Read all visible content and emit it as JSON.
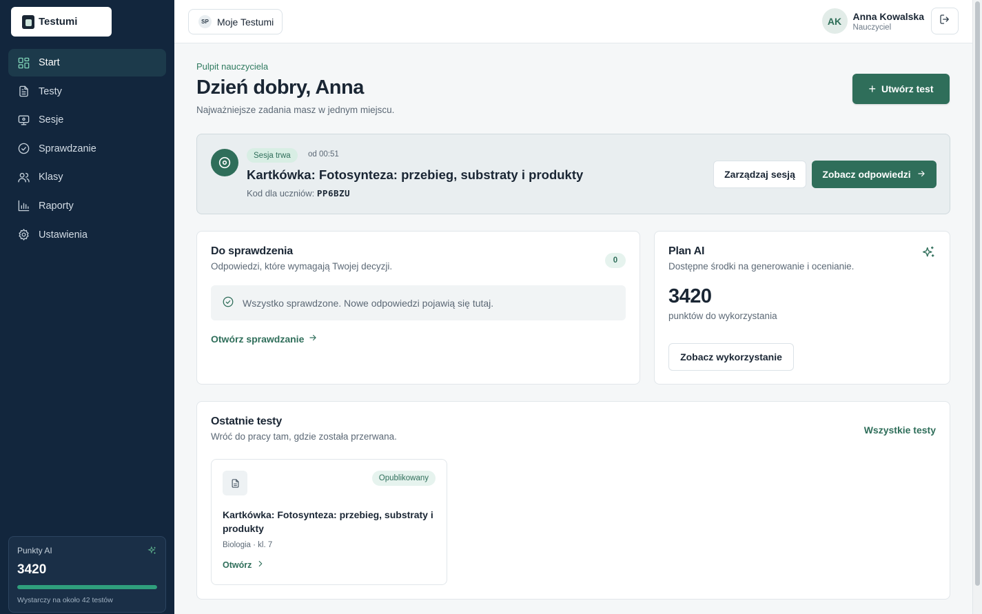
{
  "app": {
    "name": "Testumi"
  },
  "sidebar": {
    "items": [
      {
        "label": "Start",
        "icon": "dashboard-icon",
        "active": true
      },
      {
        "label": "Testy",
        "icon": "document-icon"
      },
      {
        "label": "Sesje",
        "icon": "presentation-icon"
      },
      {
        "label": "Sprawdzanie",
        "icon": "check-circle-icon"
      },
      {
        "label": "Klasy",
        "icon": "users-icon"
      },
      {
        "label": "Raporty",
        "icon": "bar-chart-icon"
      },
      {
        "label": "Ustawienia",
        "icon": "gear-icon"
      }
    ],
    "ai_points": {
      "title": "Punkty AI",
      "value": "3420",
      "progress": 1.0,
      "note": "Wystarczy na około 42 testów"
    }
  },
  "topbar": {
    "workspace_badge": "SP",
    "workspace_label": "Moje Testumi",
    "user_initials": "AK",
    "user_name": "Anna Kowalska",
    "user_role": "Nauczyciel"
  },
  "header": {
    "eyebrow": "Pulpit nauczyciela",
    "greeting": "Dzień dobry, Anna",
    "subtext": "Najważniejsze zadania masz w jednym miejscu.",
    "create_button": "Utwórz test"
  },
  "session": {
    "status": "Sesja trwa",
    "since": "od 00:51",
    "title": "Kartkówka: Fotosynteza: przebieg, substraty i produkty",
    "code_label": "Kod dla uczniów:",
    "code": "PP6BZU",
    "manage_button": "Zarządzaj sesją",
    "answers_button": "Zobacz odpowiedzi"
  },
  "review": {
    "title": "Do sprawdzenia",
    "subtitle": "Odpowiedzi, które wymagają Twojej decyzji.",
    "count": "0",
    "empty_message": "Wszystko sprawdzone. Nowe odpowiedzi pojawią się tutaj.",
    "link": "Otwórz sprawdzanie"
  },
  "plan": {
    "title": "Plan AI",
    "subtitle": "Dostępne środki na generowanie i ocenianie.",
    "value": "3420",
    "unit": "punktów do wykorzystania",
    "button": "Zobacz wykorzystanie"
  },
  "recent": {
    "title": "Ostatnie testy",
    "subtitle": "Wróć do pracy tam, gdzie została przerwana.",
    "all_link": "Wszystkie testy",
    "tests": [
      {
        "status": "Opublikowany",
        "title": "Kartkówka: Fotosynteza: przebieg, substraty i produkty",
        "meta": "Biologia · kl. 7",
        "open_link": "Otwórz"
      }
    ]
  },
  "colors": {
    "sidebar_bg": "#12263d",
    "accent": "#2f6e5a",
    "page_bg": "#f5f7f8"
  }
}
